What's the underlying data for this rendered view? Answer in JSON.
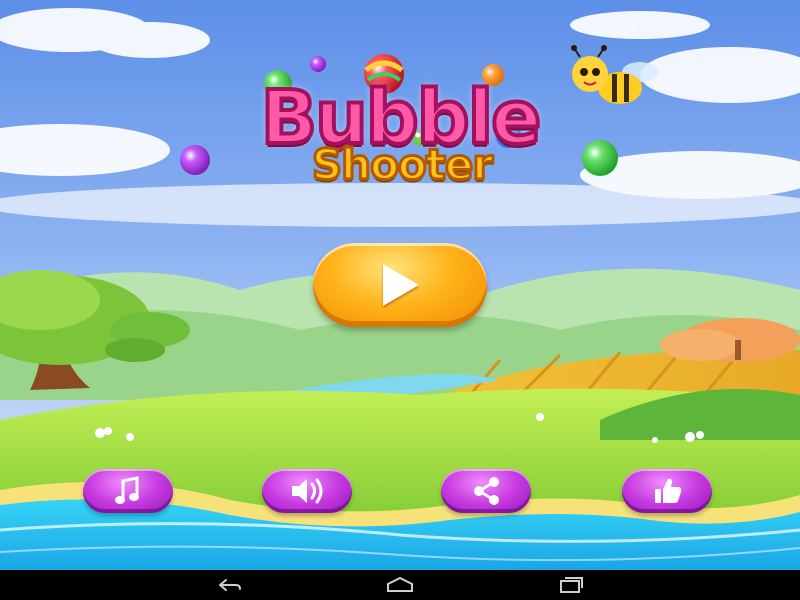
{
  "game": {
    "title_line1": "Bubble",
    "title_line2": "Shooter"
  },
  "buttons": {
    "play": {
      "icon": "play-icon"
    },
    "music": {
      "icon": "music-note-icon"
    },
    "sound": {
      "icon": "speaker-icon"
    },
    "share": {
      "icon": "share-icon"
    },
    "like": {
      "icon": "thumbs-up-icon"
    }
  },
  "navbar": {
    "back": {
      "icon": "back-icon"
    },
    "home": {
      "icon": "home-icon"
    },
    "recents": {
      "icon": "recent-apps-icon"
    }
  },
  "colors": {
    "title_pink": "#ff5aa8",
    "title_yellow": "#ffc21a",
    "play_orange": "#ffb31a",
    "button_purple": "#c73ce0",
    "sky_top": "#5a8fe6",
    "grass": "#8fd43a",
    "water": "#2ec4f0"
  }
}
